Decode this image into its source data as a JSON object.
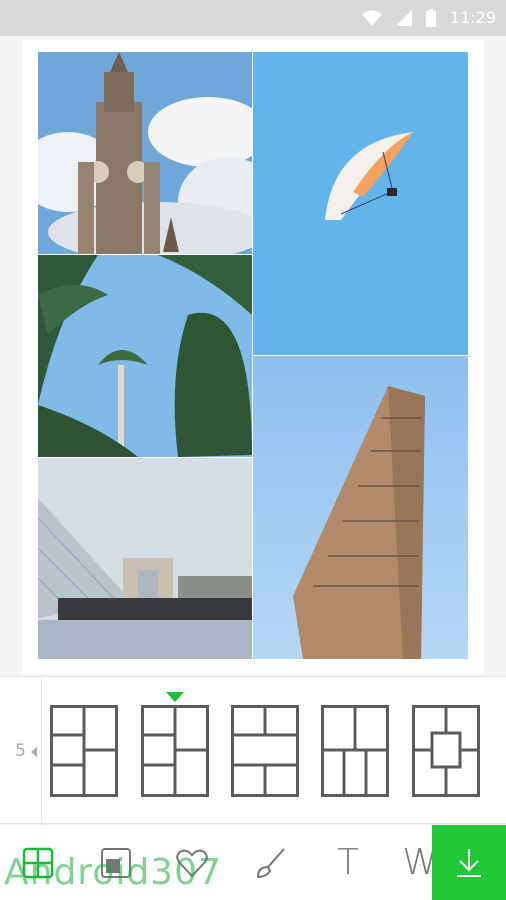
{
  "status_bar": {
    "time": "11:29",
    "icons": [
      "wifi-icon",
      "signal-icon",
      "battery-icon"
    ]
  },
  "collage": {
    "photos": [
      {
        "name": "cathedral-tower"
      },
      {
        "name": "paraglider-sky"
      },
      {
        "name": "palm-trees"
      },
      {
        "name": "flatiron-building"
      },
      {
        "name": "louvre-pyramid"
      }
    ]
  },
  "layout_picker": {
    "photo_count": "5",
    "selected_index": 1,
    "accent_color": "#17c13e"
  },
  "toolbar": {
    "tools": [
      "layout-icon",
      "border-icon",
      "sticker-heart-icon",
      "brush-icon",
      "text-icon",
      "more-icon"
    ],
    "text_tool_label": "T",
    "w_tool_label": "W",
    "download_color": "#1ec837"
  },
  "watermark": "Android307"
}
